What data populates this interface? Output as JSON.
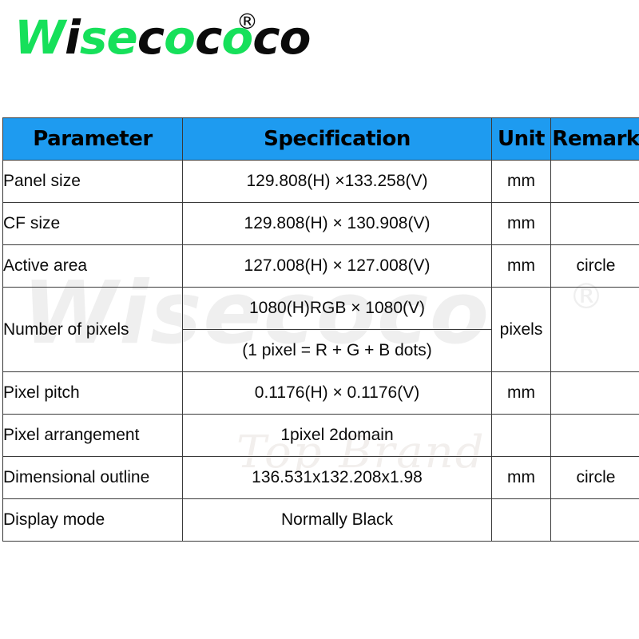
{
  "logo": {
    "segments": [
      {
        "text": "W",
        "color": "green"
      },
      {
        "text": "i",
        "color": "black"
      },
      {
        "text": "se",
        "color": "green"
      },
      {
        "text": "c",
        "color": "black"
      },
      {
        "text": "o",
        "color": "green"
      },
      {
        "text": "c",
        "color": "black"
      },
      {
        "text": "o",
        "color": "green"
      },
      {
        "text": "c",
        "color": "black"
      },
      {
        "text": "o",
        "color": "black"
      }
    ],
    "wordmark": "Wisecoco",
    "registered_symbol": "®",
    "green_hex": "#16e05a",
    "black_hex": "#0b0b0b"
  },
  "watermark": {
    "wordmark": "Wisecoco",
    "registered_symbol": "®",
    "script_text": "Top Brand",
    "color_hex": "#efefef"
  },
  "table": {
    "header_bg_hex": "#1e9bf0",
    "border_hex": "#3a3a3a",
    "columns": [
      {
        "key": "parameter",
        "label": "Parameter"
      },
      {
        "key": "specification",
        "label": "Specification"
      },
      {
        "key": "unit",
        "label": "Unit"
      },
      {
        "key": "remark",
        "label": "Remark"
      }
    ],
    "rows": [
      {
        "parameter": "Panel size",
        "specification": "129.808(H) ×133.258(V)",
        "unit": "mm",
        "remark": ""
      },
      {
        "parameter": "CF size",
        "specification": "129.808(H) × 130.908(V)",
        "unit": "mm",
        "remark": ""
      },
      {
        "parameter": "Active area",
        "specification": "127.008(H) × 127.008(V)",
        "unit": "mm",
        "remark": "circle"
      },
      {
        "parameter": "Number of pixels",
        "specification_lines": [
          "1080(H)RGB × 1080(V)",
          "(1 pixel = R + G + B dots)"
        ],
        "unit": "pixels",
        "remark": ""
      },
      {
        "parameter": "Pixel pitch",
        "specification": "0.1176(H) × 0.1176(V)",
        "unit": "mm",
        "remark": ""
      },
      {
        "parameter": "Pixel arrangement",
        "specification": "1pixel 2domain",
        "unit": "",
        "remark": ""
      },
      {
        "parameter": "Dimensional outline",
        "specification": "136.531x132.208x1.98",
        "unit": "mm",
        "remark": "circle"
      },
      {
        "parameter": "Display mode",
        "specification": "Normally Black",
        "unit": "",
        "remark": ""
      }
    ]
  }
}
